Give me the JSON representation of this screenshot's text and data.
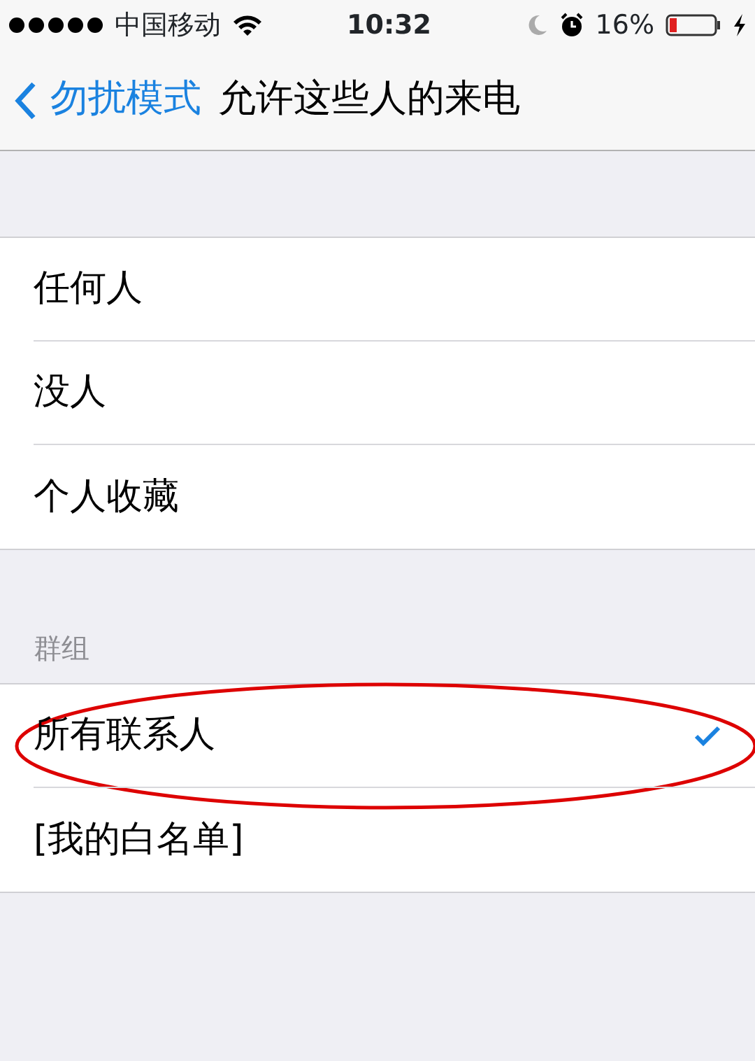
{
  "status_bar": {
    "carrier": "中国移动",
    "time": "10:32",
    "battery": "16%"
  },
  "nav": {
    "back": "勿扰模式",
    "title": "允许这些人的来电"
  },
  "sections": [
    {
      "items": [
        {
          "label": "任何人",
          "selected": false,
          "circled": false
        },
        {
          "label": "没人",
          "selected": false,
          "circled": false
        },
        {
          "label": "个人收藏",
          "selected": false,
          "circled": false
        }
      ]
    },
    {
      "header": "群组",
      "items": [
        {
          "label": "所有联系人",
          "selected": true,
          "circled": true
        },
        {
          "label": "[我的白名单]",
          "selected": false,
          "circled": false
        }
      ]
    }
  ]
}
